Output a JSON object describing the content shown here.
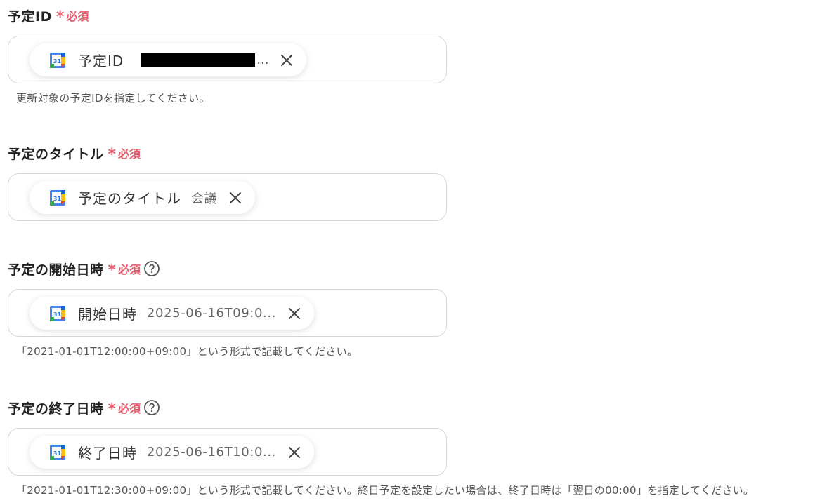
{
  "fields": [
    {
      "label": "予定ID",
      "required_star": "*",
      "required_text": "必須",
      "chip_label": "予定ID",
      "chip_value": "",
      "chip_value_truncated": "...",
      "hint": "更新対象の予定IDを指定してください。"
    },
    {
      "label": "予定のタイトル",
      "required_star": "*",
      "required_text": "必須",
      "chip_label": "予定のタイトル",
      "chip_value": "会議",
      "hint": ""
    },
    {
      "label": "予定の開始日時",
      "required_star": "*",
      "required_text": "必須",
      "chip_label": "開始日時",
      "chip_value": "2025-06-16T09:0...",
      "hint": "「2021-01-01T12:00:00+09:00」という形式で記載してください。"
    },
    {
      "label": "予定の終了日時",
      "required_star": "*",
      "required_text": "必須",
      "chip_label": "終了日時",
      "chip_value": "2025-06-16T10:0...",
      "hint": "「2021-01-01T12:30:00+09:00」という形式で記載してください。終日予定を設定したい場合は、終了日時は「翌日の00:00」を指定してください。"
    }
  ],
  "icons": {
    "calendar": "google-calendar-icon",
    "close": "close-icon",
    "help": "help-circle-icon"
  },
  "colors": {
    "required": "#e85a6a",
    "border": "#d6d6d6",
    "text": "#222222",
    "hint": "#555555"
  }
}
